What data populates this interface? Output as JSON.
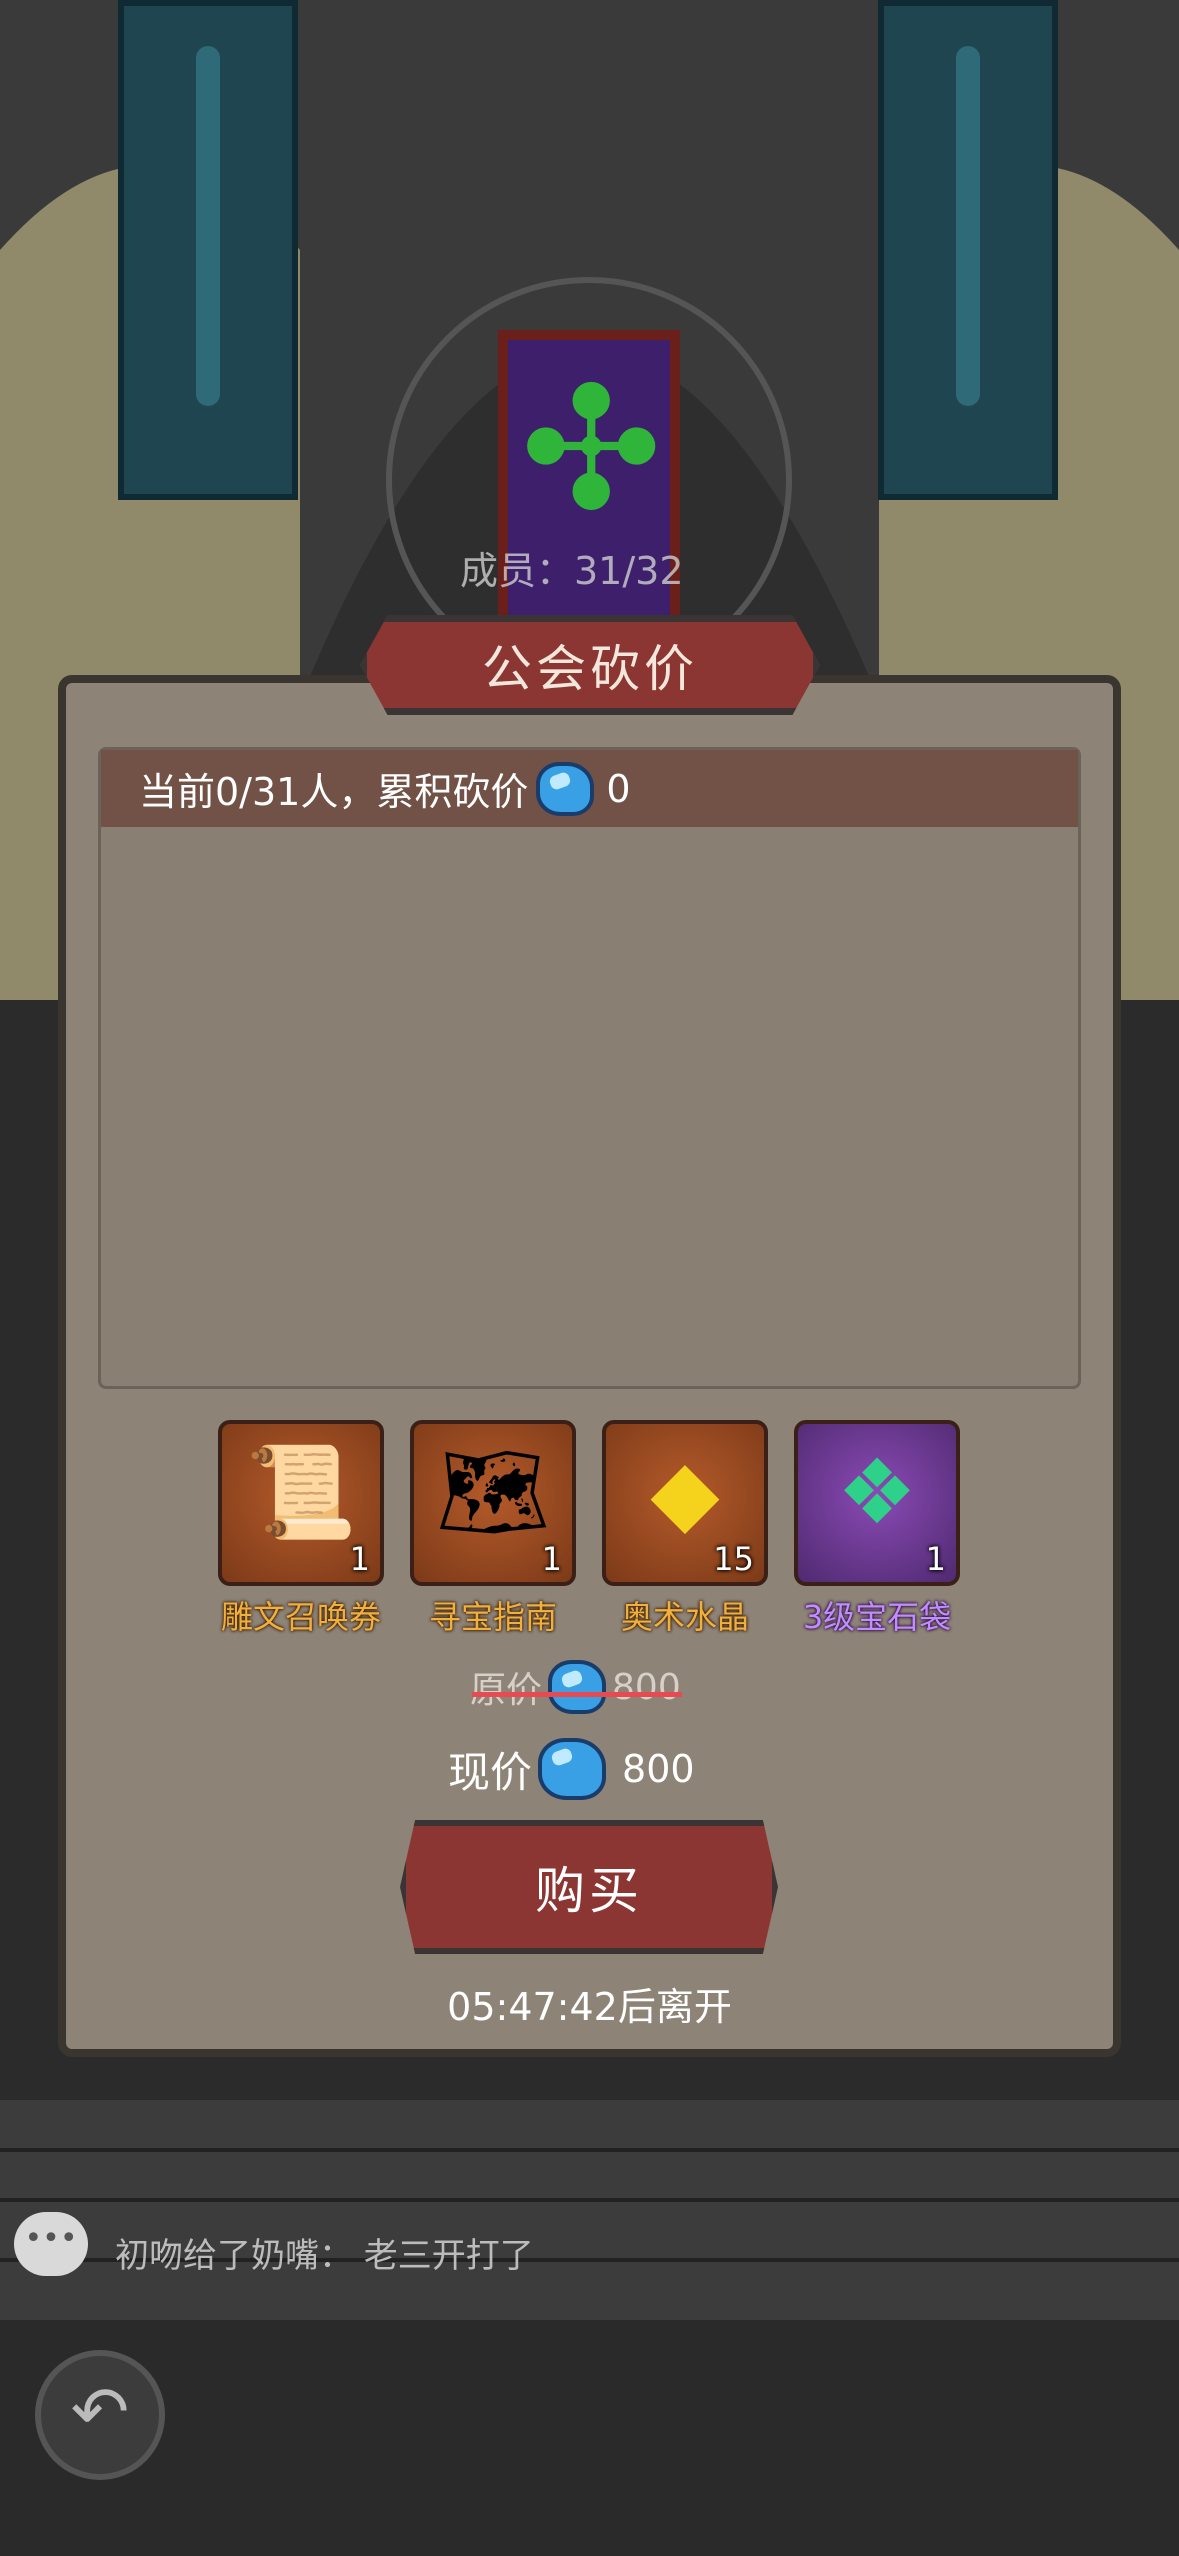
{
  "guild_hall": {
    "members_label": "成员：31/32"
  },
  "dialog": {
    "title": "公会砍价",
    "status_prefix": "当前0/31人，累积砍价",
    "accumulated_discount": "0"
  },
  "items": [
    {
      "label": "雕文召唤券",
      "count": "1",
      "icon": "scroll-icon",
      "rarity": "orange"
    },
    {
      "label": "寻宝指南",
      "count": "1",
      "icon": "treasure-map-icon",
      "rarity": "orange"
    },
    {
      "label": "奥术水晶",
      "count": "15",
      "icon": "crystal-icon",
      "rarity": "orange"
    },
    {
      "label": "3级宝石袋",
      "count": "1",
      "icon": "gem-bag-icon",
      "rarity": "purple"
    }
  ],
  "pricing": {
    "original_label": "原价",
    "original_value": "800",
    "current_label": "现价",
    "current_value": "800",
    "currency_icon": "diamond-icon"
  },
  "buy_button": {
    "label": "购买"
  },
  "timer": {
    "text": "05:47:42后离开"
  },
  "chat": {
    "message": "初吻给了奶嘴：  老三开打了"
  },
  "colors": {
    "panel": "#8e8377",
    "header": "#725246",
    "button": "#8c3634",
    "item_orange": "#f0b039",
    "item_purple": "#c08cff",
    "strike": "#e84a52"
  }
}
